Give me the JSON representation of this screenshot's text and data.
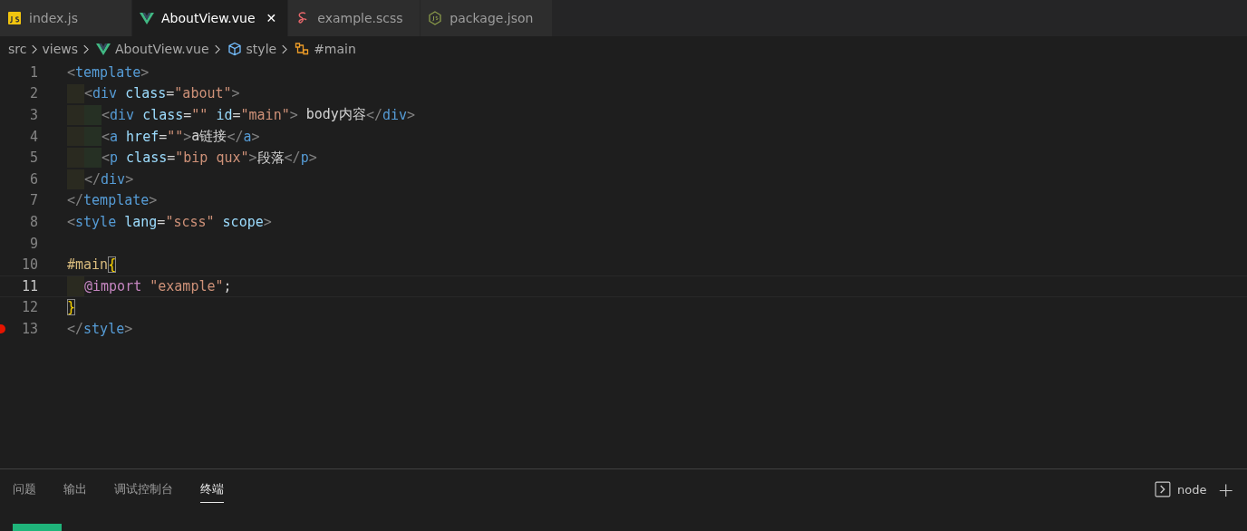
{
  "tabs": [
    {
      "label": "index.js",
      "kind": "script",
      "selected": false,
      "closable": false
    },
    {
      "label": "AboutView.vue",
      "kind": "component",
      "selected": true,
      "closable": true
    },
    {
      "label": "example.scss",
      "kind": "stylesheet",
      "selected": false,
      "closable": false
    },
    {
      "label": "package.json",
      "kind": "manifest",
      "selected": false,
      "closable": false
    }
  ],
  "close_glyph": "✕",
  "breadcrumbs": [
    {
      "label": "src",
      "kind": "folder"
    },
    {
      "label": "views",
      "kind": "folder"
    },
    {
      "label": "AboutView.vue",
      "kind": "component"
    },
    {
      "label": "style",
      "kind": "element"
    },
    {
      "label": "#main",
      "kind": "symbol"
    }
  ],
  "lines": [
    {
      "number": "1",
      "current": false,
      "breakpoint": false,
      "outer_guide": false,
      "inner_guide": false,
      "tokens": [
        {
          "kind": "punct",
          "text": "<"
        },
        {
          "kind": "tag",
          "text": "template"
        },
        {
          "kind": "punct",
          "text": ">"
        }
      ]
    },
    {
      "number": "2",
      "current": false,
      "breakpoint": false,
      "outer_guide": true,
      "inner_guide": false,
      "tokens": [
        {
          "kind": "punct",
          "text": "<"
        },
        {
          "kind": "tag",
          "text": "div"
        },
        {
          "kind": "attr",
          "text": " class"
        },
        {
          "kind": "plain",
          "text": "="
        },
        {
          "kind": "string",
          "text": "\"about\""
        },
        {
          "kind": "punct",
          "text": ">"
        }
      ]
    },
    {
      "number": "3",
      "current": false,
      "breakpoint": false,
      "outer_guide": true,
      "inner_guide": true,
      "tokens": [
        {
          "kind": "punct",
          "text": "<"
        },
        {
          "kind": "tag",
          "text": "div"
        },
        {
          "kind": "attr",
          "text": " class"
        },
        {
          "kind": "plain",
          "text": "="
        },
        {
          "kind": "string",
          "text": "\"\""
        },
        {
          "kind": "attr",
          "text": " id"
        },
        {
          "kind": "plain",
          "text": "="
        },
        {
          "kind": "string",
          "text": "\"main\""
        },
        {
          "kind": "punct",
          "text": ">"
        },
        {
          "kind": "plain",
          "text": " body内容"
        },
        {
          "kind": "punct",
          "text": "</"
        },
        {
          "kind": "tag",
          "text": "div"
        },
        {
          "kind": "punct",
          "text": ">"
        }
      ]
    },
    {
      "number": "4",
      "current": false,
      "breakpoint": false,
      "outer_guide": true,
      "inner_guide": true,
      "tokens": [
        {
          "kind": "punct",
          "text": "<"
        },
        {
          "kind": "tag",
          "text": "a"
        },
        {
          "kind": "attr",
          "text": " href"
        },
        {
          "kind": "plain",
          "text": "="
        },
        {
          "kind": "string",
          "text": "\"\""
        },
        {
          "kind": "punct",
          "text": ">"
        },
        {
          "kind": "plain",
          "text": "a链接"
        },
        {
          "kind": "punct",
          "text": "</"
        },
        {
          "kind": "tag",
          "text": "a"
        },
        {
          "kind": "punct",
          "text": ">"
        }
      ]
    },
    {
      "number": "5",
      "current": false,
      "breakpoint": false,
      "outer_guide": true,
      "inner_guide": true,
      "tokens": [
        {
          "kind": "punct",
          "text": "<"
        },
        {
          "kind": "tag",
          "text": "p"
        },
        {
          "kind": "attr",
          "text": " class"
        },
        {
          "kind": "plain",
          "text": "="
        },
        {
          "kind": "string",
          "text": "\"bip qux\""
        },
        {
          "kind": "punct",
          "text": ">"
        },
        {
          "kind": "plain",
          "text": "段落"
        },
        {
          "kind": "punct",
          "text": "</"
        },
        {
          "kind": "tag",
          "text": "p"
        },
        {
          "kind": "punct",
          "text": ">"
        }
      ]
    },
    {
      "number": "6",
      "current": false,
      "breakpoint": false,
      "outer_guide": true,
      "inner_guide": false,
      "tokens": [
        {
          "kind": "punct",
          "text": "</"
        },
        {
          "kind": "tag",
          "text": "div"
        },
        {
          "kind": "punct",
          "text": ">"
        }
      ]
    },
    {
      "number": "7",
      "current": false,
      "breakpoint": false,
      "outer_guide": false,
      "inner_guide": false,
      "tokens": [
        {
          "kind": "punct",
          "text": "</"
        },
        {
          "kind": "tag",
          "text": "template"
        },
        {
          "kind": "punct",
          "text": ">"
        }
      ]
    },
    {
      "number": "8",
      "current": false,
      "breakpoint": false,
      "outer_guide": false,
      "inner_guide": false,
      "tokens": [
        {
          "kind": "punct",
          "text": "<"
        },
        {
          "kind": "tag",
          "text": "style"
        },
        {
          "kind": "attr",
          "text": " lang"
        },
        {
          "kind": "plain",
          "text": "="
        },
        {
          "kind": "string",
          "text": "\"scss\""
        },
        {
          "kind": "attr",
          "text": " scope"
        },
        {
          "kind": "punct",
          "text": ">"
        }
      ]
    },
    {
      "number": "9",
      "current": false,
      "breakpoint": false,
      "outer_guide": false,
      "inner_guide": false
    },
    {
      "number": "10",
      "current": false,
      "breakpoint": false,
      "outer_guide": false,
      "inner_guide": false,
      "tokens": [
        {
          "kind": "selector",
          "text": "#main"
        },
        {
          "kind": "brace",
          "text": "{"
        }
      ]
    },
    {
      "number": "11",
      "current": true,
      "breakpoint": false,
      "outer_guide": true,
      "inner_guide": false,
      "tokens": [
        {
          "kind": "at",
          "text": "@import"
        },
        {
          "kind": "string",
          "text": " \"example\""
        },
        {
          "kind": "plain",
          "text": ";"
        }
      ]
    },
    {
      "number": "12",
      "current": false,
      "breakpoint": false,
      "outer_guide": false,
      "inner_guide": false,
      "tokens": [
        {
          "kind": "brace",
          "text": "}"
        }
      ]
    },
    {
      "number": "13",
      "current": false,
      "breakpoint": true,
      "outer_guide": false,
      "inner_guide": false,
      "tokens": [
        {
          "kind": "punct",
          "text": "</"
        },
        {
          "kind": "tag",
          "text": "style"
        },
        {
          "kind": "punct",
          "text": ">"
        }
      ]
    }
  ],
  "panel_tabs": [
    {
      "label": "问题",
      "selected": false
    },
    {
      "label": "输出",
      "selected": false
    },
    {
      "label": "调试控制台",
      "selected": false
    },
    {
      "label": "终端",
      "selected": true
    }
  ],
  "terminal": {
    "name": "node",
    "add_glyph": "+"
  }
}
